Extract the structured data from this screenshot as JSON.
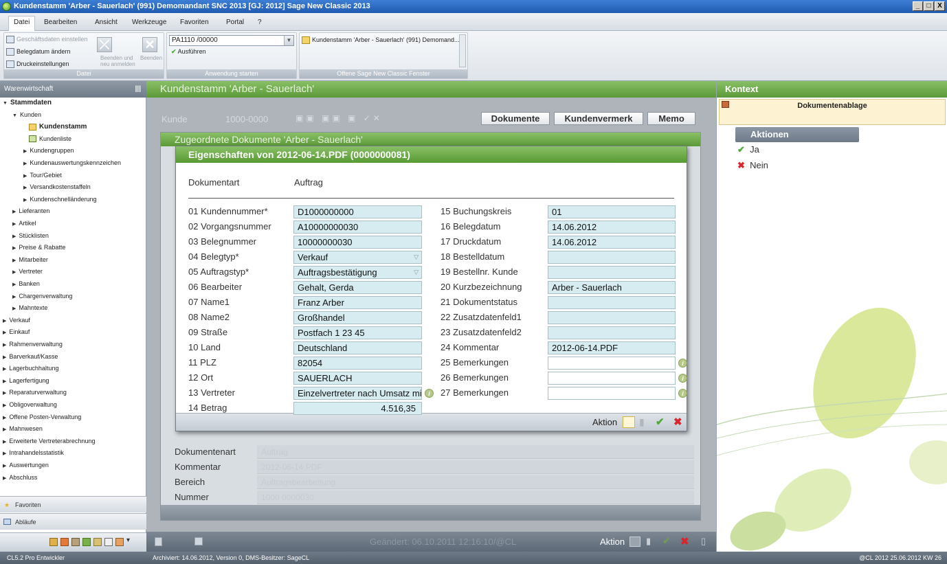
{
  "window": {
    "title": "Kundenstamm  'Arber - Sauerlach' (991) Demomandant SNC 2013 [GJ: 2012] Sage New Classic 2013",
    "minimize": "_",
    "maximize": "□",
    "close": "X"
  },
  "menu": [
    "Datei",
    "Bearbeiten",
    "Ansicht",
    "Werkzeuge",
    "Favoriten",
    "Portal",
    "?"
  ],
  "ribbon": {
    "datei": {
      "title": "Datei",
      "geschaeftsdaten": "Geschäftsdaten einstellen",
      "belegdatum": "Belegdatum ändern",
      "druck": "Druckeinstellungen",
      "beenden_neu": "Beenden und neu anmelden",
      "beenden": "Beenden"
    },
    "anwendung": {
      "title": "Anwendung starten",
      "combo_value": "PA1110 /00000",
      "ausfuehren": "Ausführen"
    },
    "offene": {
      "title": "Offene Sage New Classic Fenster",
      "item": "Kundenstamm 'Arber - Sauerlach' (991) Demomand..."
    }
  },
  "left": {
    "header": "Warenwirtschaft",
    "tree": [
      {
        "label": "Stammdaten",
        "level": 0,
        "open": true,
        "bold": true
      },
      {
        "label": "Kunden",
        "level": 1,
        "open": true
      },
      {
        "label": "Kundenstamm",
        "level": 2,
        "leaf": true,
        "bold": true,
        "icon": "folder"
      },
      {
        "label": "Kundenliste",
        "level": 2,
        "leaf": true,
        "icon": "printer"
      },
      {
        "label": "Kundengruppen",
        "level": 2
      },
      {
        "label": "Kundenauswertungskennzeichen",
        "level": 2
      },
      {
        "label": "Tour/Gebiet",
        "level": 2
      },
      {
        "label": "Versandkostenstaffeln",
        "level": 2
      },
      {
        "label": "Kundenschnelländerung",
        "level": 2
      },
      {
        "label": "Lieferanten",
        "level": 1
      },
      {
        "label": "Artikel",
        "level": 1
      },
      {
        "label": "Stücklisten",
        "level": 1
      },
      {
        "label": "Preise & Rabatte",
        "level": 1
      },
      {
        "label": "Mitarbeiter",
        "level": 1
      },
      {
        "label": "Vertreter",
        "level": 1
      },
      {
        "label": "Banken",
        "level": 1
      },
      {
        "label": "Chargenverwaltung",
        "level": 1
      },
      {
        "label": "Mahntexte",
        "level": 1
      },
      {
        "label": "Verkauf",
        "level": 0
      },
      {
        "label": "Einkauf",
        "level": 0
      },
      {
        "label": "Rahmenverwaltung",
        "level": 0
      },
      {
        "label": "Barverkauf/Kasse",
        "level": 0
      },
      {
        "label": "Lagerbuchhaltung",
        "level": 0
      },
      {
        "label": "Lagerfertigung",
        "level": 0
      },
      {
        "label": "Reparaturverwaltung",
        "level": 0
      },
      {
        "label": "Obligoverwaltung",
        "level": 0
      },
      {
        "label": "Offene Posten-Verwaltung",
        "level": 0
      },
      {
        "label": "Mahnwesen",
        "level": 0
      },
      {
        "label": "Erweiterte Vertreterabrechnung",
        "level": 0
      },
      {
        "label": "Intrahandelsstatistik",
        "level": 0
      },
      {
        "label": "Auswertungen",
        "level": 0
      },
      {
        "label": "Abschluss",
        "level": 0
      }
    ],
    "favoriten": "Favoriten",
    "ablaeufe": "Abläufe"
  },
  "center": {
    "header": "Kundenstamm  'Arber - Sauerlach'",
    "kunde_label": "Kunde",
    "kunde_value": "1000-0000",
    "btn_dokumente": "Dokumente",
    "btn_kundenvermerk": "Kundenvermerk",
    "btn_memo": "Memo",
    "doc_header": "Zugeordnete Dokumente 'Arber - Sauerlach'",
    "doc_fields": [
      {
        "label": "Dokumentenart",
        "value": "Auftrag"
      },
      {
        "label": "Kommentar",
        "value": "2012-06-14.PDF"
      },
      {
        "label": "Bereich",
        "value": "Auftragsbearbeitung"
      },
      {
        "label": "Nummer",
        "value": "1000 0000030"
      }
    ],
    "foot_changed": "Geändert: 06.10.2011 12:16:10/@CL",
    "foot_aktion": "Aktion"
  },
  "dialog": {
    "title": "Eigenschaften von 2012-06-14.PDF (0000000081)",
    "dokumentart_label": "Dokumentart",
    "dokumentart_value": "Auftrag",
    "left_fields": [
      {
        "label": "01 Kundennummer*",
        "value": "D1000000000"
      },
      {
        "label": "02 Vorgangsnummer",
        "value": "A10000000030"
      },
      {
        "label": "03 Belegnummer",
        "value": "10000000030"
      },
      {
        "label": "04 Belegtyp*",
        "value": "Verkauf",
        "dropdown": true
      },
      {
        "label": "05 Auftragstyp*",
        "value": "Auftragsbestätigung",
        "dropdown": true
      },
      {
        "label": "06 Bearbeiter",
        "value": "Gehalt, Gerda"
      },
      {
        "label": "07 Name1",
        "value": "Franz Arber"
      },
      {
        "label": "08 Name2",
        "value": "Großhandel"
      },
      {
        "label": "09 Straße",
        "value": "Postfach 1 23 45"
      },
      {
        "label": "10 Land",
        "value": "Deutschland"
      },
      {
        "label": "11 PLZ",
        "value": "82054"
      },
      {
        "label": "12 Ort",
        "value": "SAUERLACH"
      },
      {
        "label": "13 Vertreter",
        "value": "Einzelvertreter nach Umsatz mi",
        "info": true
      },
      {
        "label": "14 Betrag",
        "value": "4.516,35",
        "right": true
      }
    ],
    "right_fields": [
      {
        "label": "15 Buchungskreis",
        "value": "01"
      },
      {
        "label": "16 Belegdatum",
        "value": "14.06.2012"
      },
      {
        "label": "17 Druckdatum",
        "value": "14.06.2012"
      },
      {
        "label": "18 Bestelldatum",
        "value": ""
      },
      {
        "label": "19 Bestellnr. Kunde",
        "value": ""
      },
      {
        "label": "20 Kurzbezeichnung",
        "value": "Arber - Sauerlach"
      },
      {
        "label": "21 Dokumentstatus",
        "value": ""
      },
      {
        "label": "22 Zusatzdatenfeld1",
        "value": ""
      },
      {
        "label": "23 Zusatzdatenfeld2",
        "value": ""
      },
      {
        "label": "24 Kommentar",
        "value": "2012-06-14.PDF"
      },
      {
        "label": "25 Bemerkungen",
        "value": "",
        "white": true,
        "info": true
      },
      {
        "label": "26 Bemerkungen",
        "value": "",
        "white": true,
        "info": true
      },
      {
        "label": "27 Bemerkungen",
        "value": "",
        "white": true,
        "info": true
      }
    ],
    "aktion": "Aktion"
  },
  "right": {
    "header": "Kontext",
    "dokumentenablage": "Dokumentenablage",
    "aktionen": "Aktionen",
    "ja": "Ja",
    "nein": "Nein"
  },
  "status": {
    "left": "CL5.2 Pro Entwickler",
    "middle": "Archiviert: 14.06.2012, Version 0, DMS-Besitzer: SageCL",
    "right": "@CL 2012  25.06.2012   KW 26"
  },
  "colors": {
    "accent_green": "#6aa845",
    "title_blue": "#2a6ac4",
    "field_blue": "#d6ecf1"
  }
}
